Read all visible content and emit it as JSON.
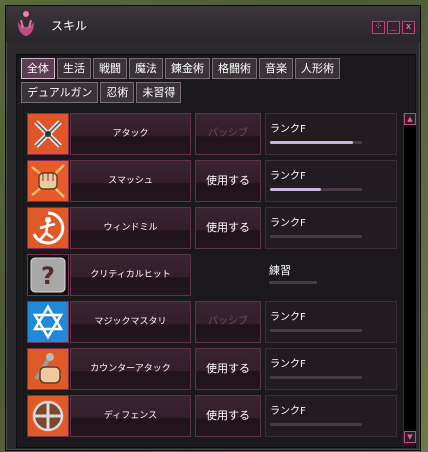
{
  "window": {
    "title": "スキル",
    "controls": [
      "⁘",
      "_",
      "x"
    ]
  },
  "tabs": {
    "row1": [
      "全体",
      "生活",
      "戦闘",
      "魔法",
      "錬金術",
      "格闘術",
      "音楽",
      "人形術"
    ],
    "row2": [
      "デュアルガン",
      "忍術",
      "未習得"
    ],
    "active": "全体"
  },
  "skills": [
    {
      "name": "アタック",
      "action": "パッシブ",
      "action_enabled": false,
      "rank": "ランクF",
      "progress": 0.9,
      "icon": "crossed-swords-icon"
    },
    {
      "name": "スマッシュ",
      "action": "使用する",
      "action_enabled": true,
      "rank": "ランクF",
      "progress": 0.55,
      "icon": "fist-icon"
    },
    {
      "name": "ウィンドミル",
      "action": "使用する",
      "action_enabled": true,
      "rank": "ランクF",
      "progress": 0.0,
      "icon": "windmill-icon"
    },
    {
      "name": "クリティカルヒット",
      "action": "",
      "action_enabled": false,
      "rank": "練習",
      "progress": 0.0,
      "icon": "question-icon"
    },
    {
      "name": "マジックマスタリ",
      "action": "パッシブ",
      "action_enabled": false,
      "rank": "ランクF",
      "progress": 0.0,
      "icon": "hexagram-icon"
    },
    {
      "name": "カウンターアタック",
      "action": "使用する",
      "action_enabled": true,
      "rank": "ランクF",
      "progress": 0.0,
      "icon": "counter-fist-icon"
    },
    {
      "name": "ディフェンス",
      "action": "使用する",
      "action_enabled": true,
      "rank": "ランクF",
      "progress": 0.0,
      "icon": "shield-icon"
    }
  ],
  "colors": {
    "accent": "#c0407a",
    "progress": "#c9b6e0",
    "active_tab": "#5c3d52"
  }
}
